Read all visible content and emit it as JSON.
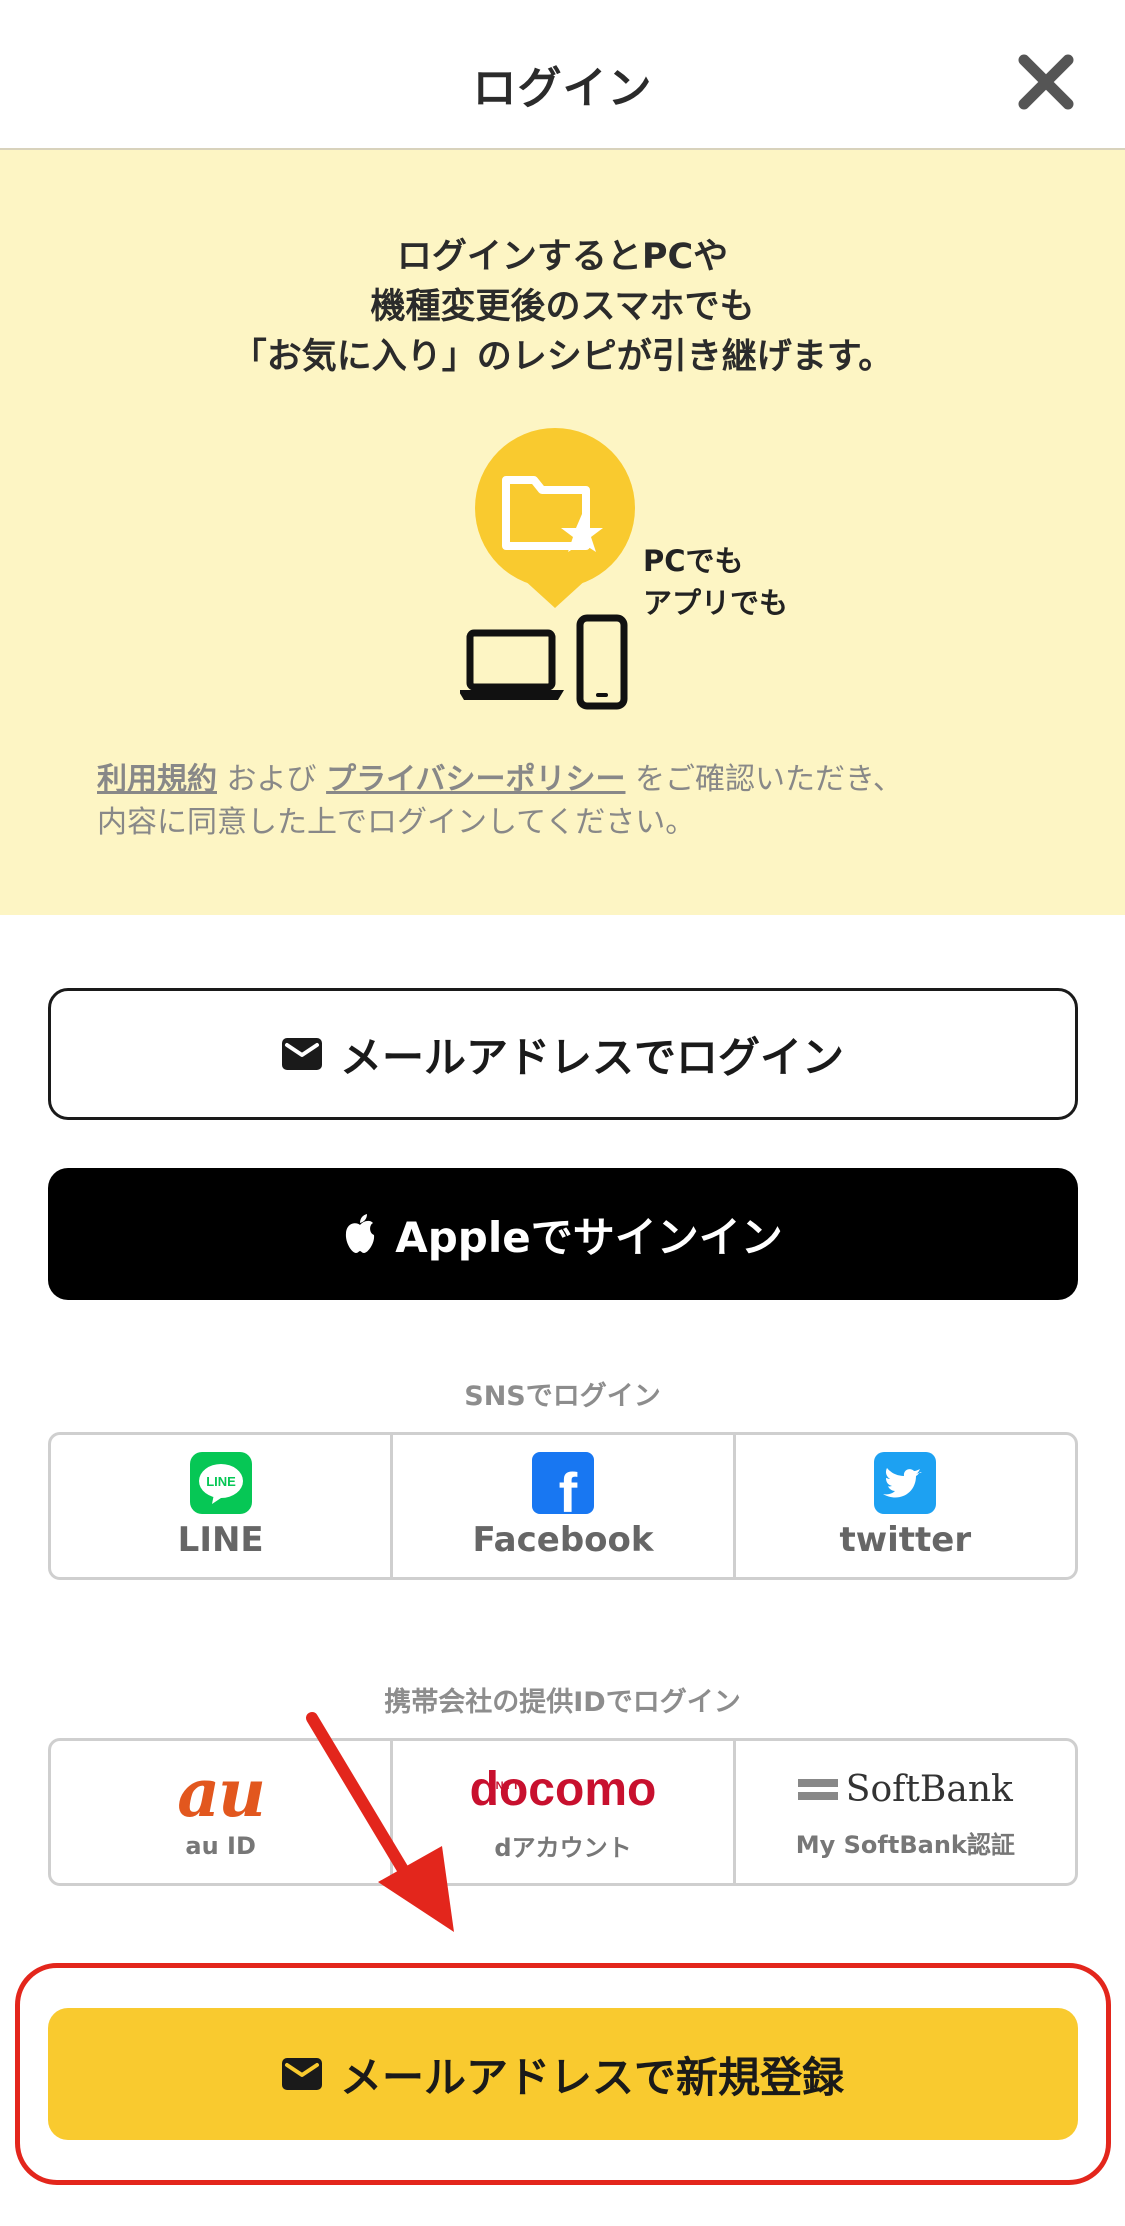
{
  "header": {
    "title": "ログイン",
    "close_icon": "close-icon"
  },
  "info": {
    "lead_lines": [
      "ログインするとPCや",
      "機種変更後のスマホでも",
      "「お気に入り」のレシピが引き継げます。"
    ],
    "badge_lines": [
      "PCでも",
      "アプリでも"
    ],
    "terms": {
      "link1": "利用規約",
      "text1": " および ",
      "link2": "プライバシーポリシー",
      "text2": " をご確認いただき、",
      "text3": "内容に同意した上でログインしてください。"
    }
  },
  "buttons": {
    "mail_login": "メールアドレスでログイン",
    "apple_signin": "Appleでサインイン",
    "mail_register": "メールアドレスで新規登録"
  },
  "sns": {
    "label": "SNSでログイン",
    "items": [
      {
        "label": "LINE",
        "icon": "line-icon",
        "color": "#06c755",
        "icon_text": "LINE"
      },
      {
        "label": "Facebook",
        "icon": "facebook-icon",
        "color": "#1877f2",
        "icon_text": "f"
      },
      {
        "label": "twitter",
        "icon": "twitter-icon",
        "color": "#1da1f2"
      }
    ]
  },
  "carrier": {
    "label": "携帯会社の提供IDでログイン",
    "items": [
      {
        "logo": "au",
        "label": "au ID",
        "color": "#e2571e"
      },
      {
        "logo": "docomo",
        "logo_small": "NTT",
        "label": "dアカウント",
        "color": "#c8102e"
      },
      {
        "logo": "SoftBank",
        "label": "My SoftBank認証"
      }
    ]
  },
  "colors": {
    "accent_yellow": "#f9ca2f",
    "panel": "#fdf5c4",
    "annotation_red": "#e3261c"
  }
}
